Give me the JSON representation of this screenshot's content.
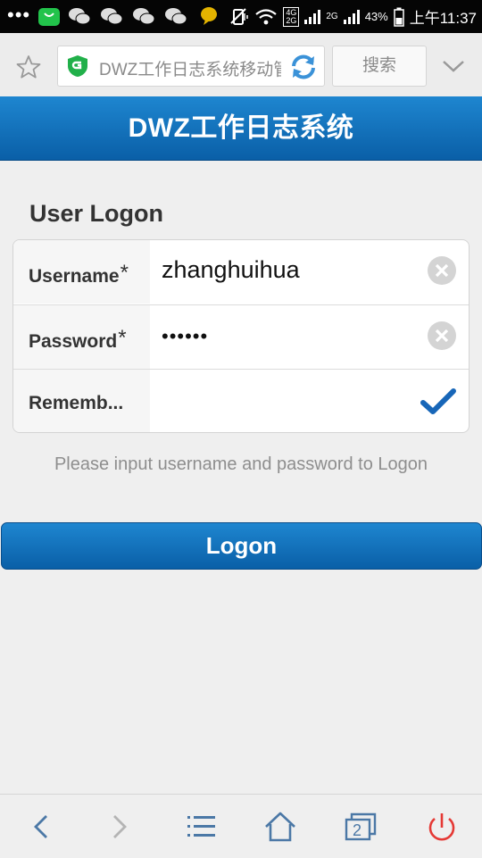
{
  "status_bar": {
    "overflow_dots": "•••",
    "app_icons": [
      "shop-bag-icon",
      "wechat-icon",
      "wechat-icon",
      "wechat-icon",
      "wechat-icon",
      "chat-bubble-icon"
    ],
    "network_4g": "4G",
    "network_2g_top": "2G",
    "network_2g": "2G",
    "battery": "43%",
    "time": "上午11:37"
  },
  "browser": {
    "url": "DWZ工作日志系统移动管",
    "search_label": "搜索"
  },
  "header": {
    "title": "DWZ工作日志系统"
  },
  "form": {
    "title": "User Logon",
    "username_label": "Username",
    "username_required": "*",
    "username_value": "zhanghuihua",
    "password_label": "Password",
    "password_required": "*",
    "password_value": "••••••",
    "remember_label": "Rememb...",
    "remember_checked": true,
    "hint": "Please input username and password to Logon",
    "submit_label": "Logon"
  },
  "toolbar": {
    "tab_count": "2"
  },
  "colors": {
    "accent": "#0a6bb8",
    "power": "#e53935"
  }
}
